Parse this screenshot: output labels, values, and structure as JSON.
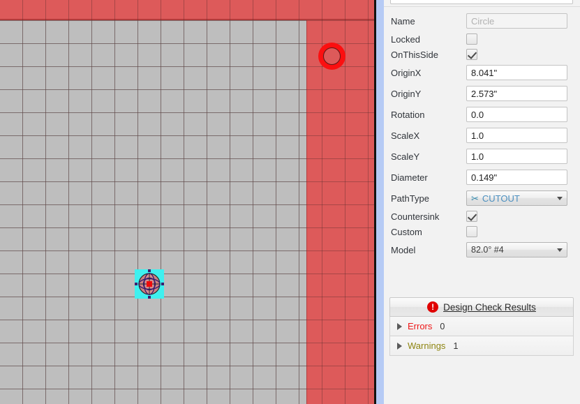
{
  "canvas": {
    "selected_object_name": "selected-shape",
    "circle_feature_name": "circle-cutout-hole",
    "colors": {
      "grid_background": "#bebebe",
      "grid_line": "#8d8d8d",
      "red_region": "#dd5a5a",
      "hole_ring": "#fb0f10",
      "selection_box": "#3ff0ef",
      "scrollbar": "#b6cbf5"
    }
  },
  "properties": {
    "rows": [
      {
        "label": "Name",
        "type": "text",
        "value": "",
        "placeholder": "Circle"
      },
      {
        "label": "Locked",
        "type": "checkbox",
        "checked": false
      },
      {
        "label": "OnThisSide",
        "type": "checkbox",
        "checked": true
      },
      {
        "label": "OriginX",
        "type": "text",
        "value": "8.041\""
      },
      {
        "label": "OriginY",
        "type": "text",
        "value": "2.573\""
      },
      {
        "label": "Rotation",
        "type": "text",
        "value": "0.0"
      },
      {
        "label": "ScaleX",
        "type": "text",
        "value": "1.0"
      },
      {
        "label": "ScaleY",
        "type": "text",
        "value": "1.0"
      },
      {
        "label": "Diameter",
        "type": "text",
        "value": "0.149\""
      },
      {
        "label": "PathType",
        "type": "dropdown",
        "value": "CUTOUT",
        "icon": "scissors-icon",
        "accent": true
      },
      {
        "label": "Countersink",
        "type": "checkbox",
        "checked": true
      },
      {
        "label": "Custom",
        "type": "checkbox",
        "checked": false
      },
      {
        "label": "Model",
        "type": "dropdown",
        "value": "82.0° #4"
      }
    ],
    "labels": {
      "name": "Name",
      "locked": "Locked",
      "on_this_side": "OnThisSide",
      "origin_x": "OriginX",
      "origin_y": "OriginY",
      "rotation": "Rotation",
      "scale_x": "ScaleX",
      "scale_y": "ScaleY",
      "diameter": "Diameter",
      "path_type": "PathType",
      "countersink": "Countersink",
      "custom": "Custom",
      "model": "Model"
    },
    "values": {
      "name_placeholder": "Circle",
      "origin_x": "8.041\"",
      "origin_y": "2.573\"",
      "rotation": "0.0",
      "scale_x": "1.0",
      "scale_y": "1.0",
      "diameter": "0.149\"",
      "path_type": "CUTOUT",
      "model": "82.0° #4"
    }
  },
  "design_check": {
    "title": "Design Check Results",
    "badge_glyph": "!",
    "rows": [
      {
        "label": "Errors",
        "count": "0",
        "color": "#ef1717"
      },
      {
        "label": "Warnings",
        "count": "1",
        "color": "#8e8511"
      }
    ],
    "errors_label": "Errors",
    "errors_count": "0",
    "warnings_label": "Warnings",
    "warnings_count": "1"
  }
}
